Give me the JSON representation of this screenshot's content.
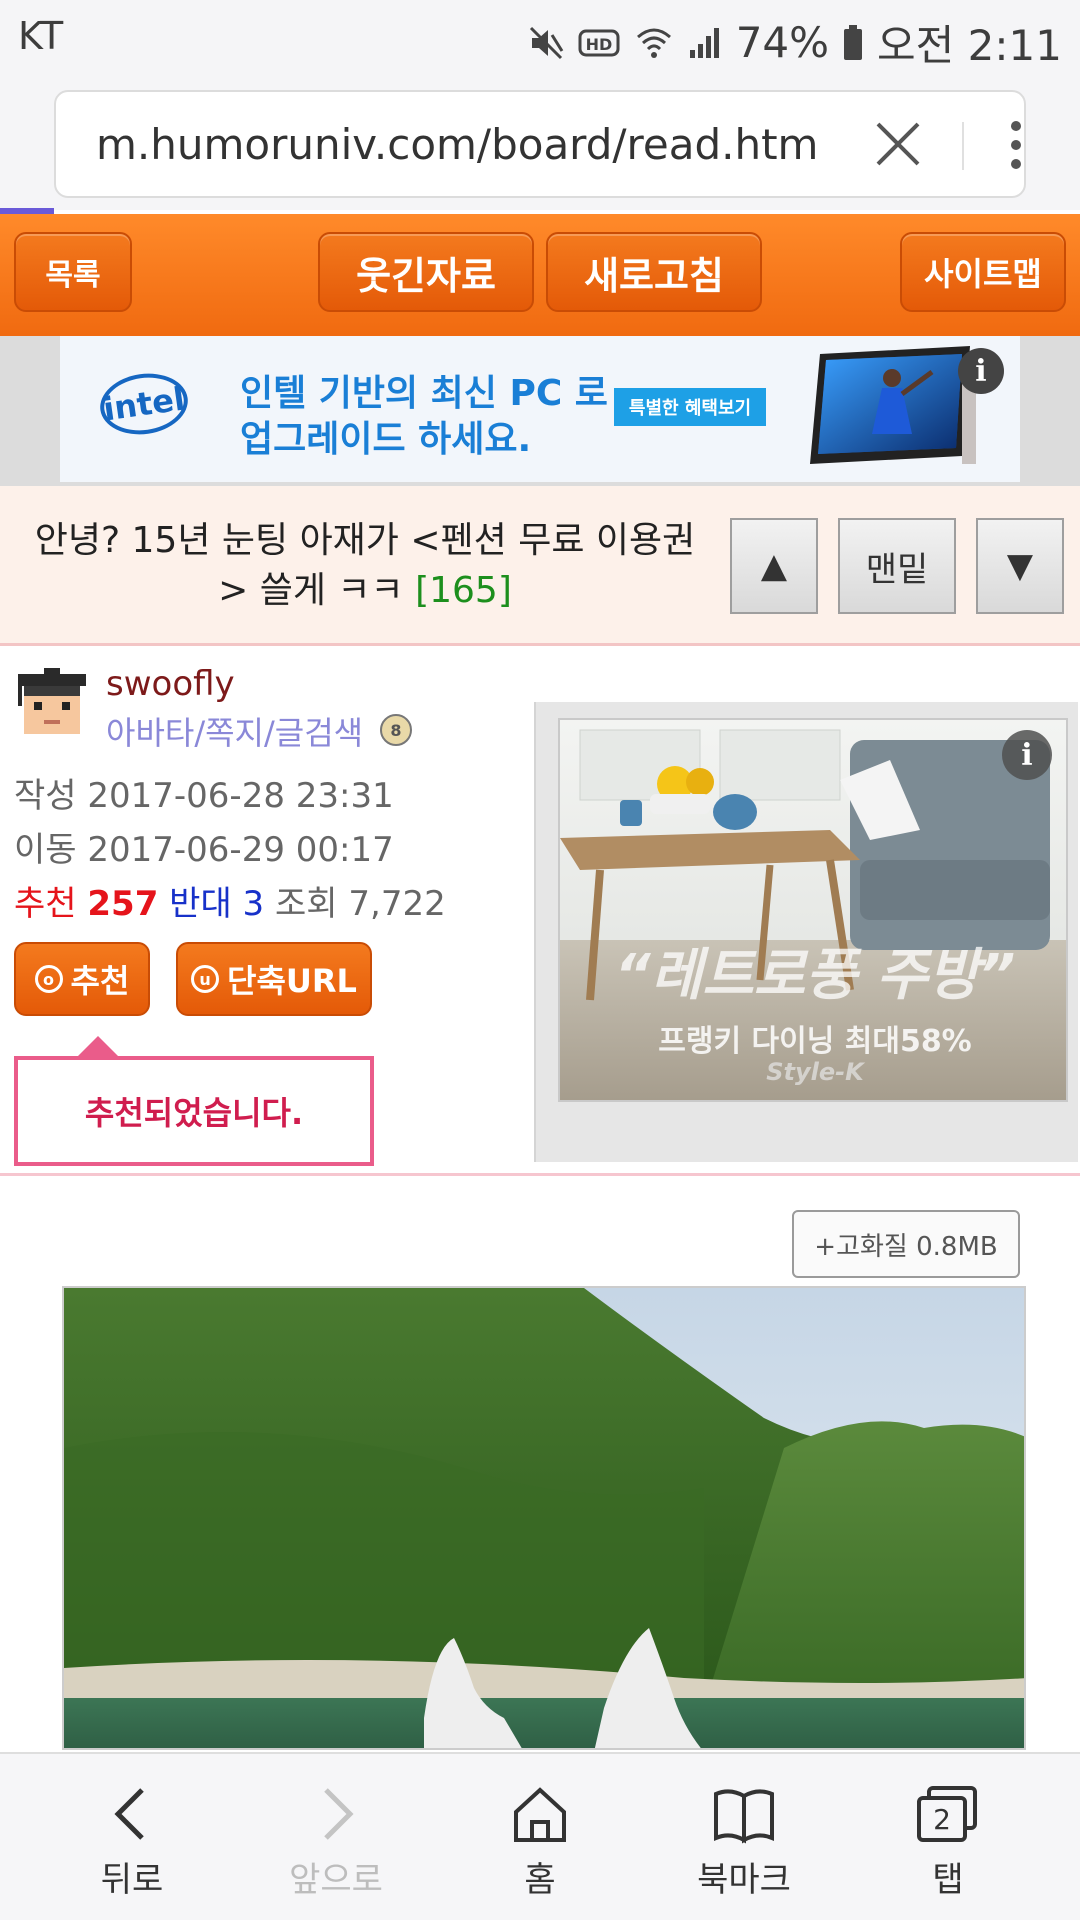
{
  "status": {
    "carrier": "KT",
    "battery": "74%",
    "time": "오전 2:11",
    "icons": [
      "mute-icon",
      "hd-icon",
      "wifi-icon",
      "signal-icon",
      "battery-icon"
    ]
  },
  "browser": {
    "url": "m.humoruniv.com/board/read.htm",
    "close_icon": "close-icon",
    "menu_icon": "kebab-menu-icon"
  },
  "nav": {
    "list": "목록",
    "funny": "웃긴자료",
    "refresh": "새로고침",
    "sitemap": "사이트맵"
  },
  "top_ad": {
    "logo": "intel",
    "line1": "인텔 기반의 최신 PC 로",
    "line2": "업그레이드 하세요.",
    "cta": "특별한 혜택보기"
  },
  "post": {
    "title": "안녕? 15년 눈팅 아재가 <펜션 무료 이용권> 쓸게 ㅋㅋ",
    "comment_count": "[165]",
    "up_label": "▲",
    "bottom_label": "맨밑",
    "down_label": "▼"
  },
  "author": {
    "name": "swoofly",
    "links": "아바타/쪽지/글검색",
    "written_label": "작성",
    "written": "2017-06-28 23:31",
    "moved_label": "이동",
    "moved": "2017-06-29 00:17",
    "recommend_label": "추천",
    "recommend_count": "257",
    "oppose_label": "반대",
    "oppose_count": "3",
    "views_label": "조회",
    "views": "7,722",
    "recommend_button": "추천",
    "short_url_button": "단축URL",
    "recommended_tip": "추천되었습니다."
  },
  "side_ad": {
    "headline": "“레트로풍 주방”",
    "sub": "프랭키 다이닝 최대58%",
    "brand": "Style-K"
  },
  "content": {
    "hq_button": "+고화질 0.8MB"
  },
  "toolbar": {
    "back": "뒤로",
    "forward": "앞으로",
    "home": "홈",
    "bookmarks": "북마크",
    "tabs": "탭",
    "tab_count": "2"
  },
  "colors": {
    "nav_orange": "#f06a10",
    "title_count_green": "#1d8f1d",
    "recommend_red": "#e5141b",
    "oppose_blue": "#1731c9",
    "tip_pink": "#ea5c8a",
    "progress_purple": "#6a5ad8"
  }
}
